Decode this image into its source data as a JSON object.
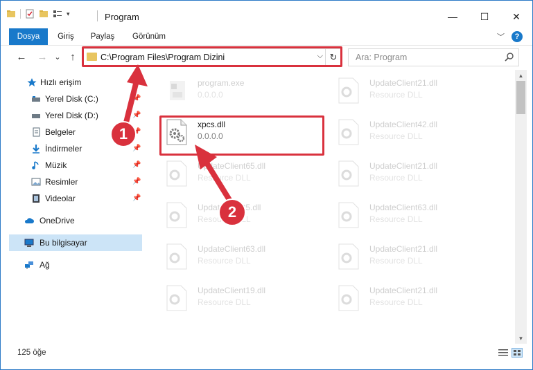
{
  "window": {
    "title": "Program",
    "minimize": "—",
    "maximize": "☐",
    "close": "✕"
  },
  "ribbon": {
    "tabs": [
      "Dosya",
      "Giriş",
      "Paylaş",
      "Görünüm"
    ],
    "expand": "﹀",
    "help": "?"
  },
  "nav": {
    "back": "←",
    "forward": "→",
    "recent": "⌄",
    "up": "↑",
    "address": "C:\\Program Files\\Program Dizini",
    "address_dropdown": "⌵",
    "refresh": "↻",
    "search_placeholder": "Ara: Program"
  },
  "sidebar": {
    "quick_access": "Hızlı erişim",
    "items": [
      {
        "label": "Yerel Disk (C:)",
        "icon": "drive-icon"
      },
      {
        "label": "Yerel Disk (D:)",
        "icon": "drive-icon"
      },
      {
        "label": "Belgeler",
        "icon": "documents-icon"
      },
      {
        "label": "İndirmeler",
        "icon": "downloads-icon"
      },
      {
        "label": "Müzik",
        "icon": "music-icon"
      },
      {
        "label": "Resimler",
        "icon": "pictures-icon"
      },
      {
        "label": "Videolar",
        "icon": "videos-icon"
      }
    ],
    "onedrive": "OneDrive",
    "this_pc": "Bu bilgisayar",
    "network": "Ağ"
  },
  "files": {
    "left": [
      {
        "name": "program.exe",
        "sub": "0.0.0.0",
        "kind": "exe"
      },
      {
        "name": "xpcs.dll",
        "sub": "0.0.0.0",
        "kind": "dll"
      },
      {
        "name": "UpdateClient65.dll",
        "sub": "Resource DLL",
        "kind": "dll"
      },
      {
        "name": "UpdateClient5.dll",
        "sub": "Resource DLL",
        "kind": "dll"
      },
      {
        "name": "UpdateClient63.dll",
        "sub": "Resource DLL",
        "kind": "dll"
      },
      {
        "name": "UpdateClient19.dll",
        "sub": "Resource DLL",
        "kind": "dll"
      }
    ],
    "right": [
      {
        "name": "UpdateClient21.dll",
        "sub": "Resource DLL",
        "kind": "dll"
      },
      {
        "name": "UpdateClient42.dll",
        "sub": "Resource DLL",
        "kind": "dll"
      },
      {
        "name": "UpdateClient21.dll",
        "sub": "Resource DLL",
        "kind": "dll"
      },
      {
        "name": "UpdateClient63.dll",
        "sub": "Resource DLL",
        "kind": "dll"
      },
      {
        "name": "UpdateClient21.dll",
        "sub": "Resource DLL",
        "kind": "dll"
      },
      {
        "name": "UpdateClient21.dll",
        "sub": "Resource DLL",
        "kind": "dll"
      }
    ]
  },
  "status": {
    "count": "125 öğe"
  },
  "callouts": {
    "one": "1",
    "two": "2",
    "color": "#d9313d"
  },
  "colors": {
    "accent": "#1979ca",
    "selected": "#cce4f7",
    "highlight": "#d9313d"
  }
}
